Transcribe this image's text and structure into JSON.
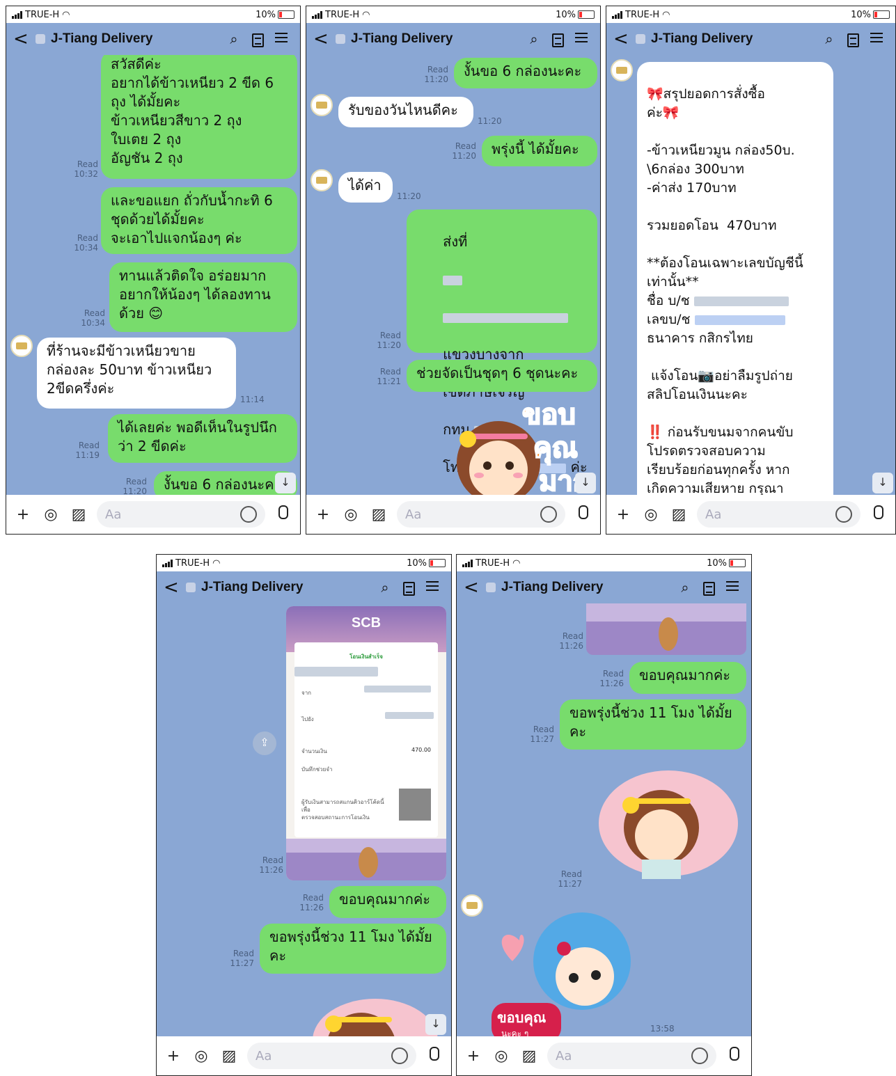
{
  "app": {
    "carrier": "TRUE-H",
    "battery": "10%",
    "chat_title": "J-Tiang Delivery",
    "input_placeholder": "Aa",
    "back_glyph": "<"
  },
  "icons": [
    "back-icon",
    "search-icon",
    "notes-icon",
    "menu-icon",
    "plus-icon",
    "camera-icon",
    "image-icon",
    "emoji-icon",
    "mic-icon"
  ],
  "screen1": {
    "m1": {
      "read": "Read",
      "time": "10:32",
      "text": "สวัสดีค่ะ\nอยากได้ข้าวเหนียว 2 ขีด 6\nถุง ได้มั้ยคะ\nข้าวเหนียวสีขาว 2 ถุง\nใบเตย 2 ถุง\nอัญชัน 2 ถุง"
    },
    "m2": {
      "read": "Read",
      "time": "10:34",
      "text": "และขอแยก ถั่วกับน้ำกะทิ 6\nชุดด้วยได้มั้ยคะ\nจะเอาไปแจกน้องๆ ค่ะ"
    },
    "m3": {
      "read": "Read",
      "time": "10:34",
      "text": "ทานแล้วติดใจ อร่อยมาก\nอยากให้น้องๆ ได้ลองทาน\nด้วย 😊"
    },
    "m4": {
      "time": "11:14",
      "text": "ที่ร้านจะมีข้าวเหนียวขาย\nกล่องละ 50บาท ข้าวเหนียว\n2ขีดครึ่งค่ะ"
    },
    "m5": {
      "read": "Read",
      "time": "11:19",
      "text": "ได้เลยค่ะ พอดีเห็นในรูปนึก\nว่า 2 ขีดค่ะ"
    },
    "m6": {
      "read": "Read",
      "time": "11:20",
      "text": "งั้นขอ 6 กล่องนะค"
    }
  },
  "screen2": {
    "m1": {
      "read": "Read",
      "time": "11:20",
      "text": "งั้นขอ 6 กล่องนะคะ"
    },
    "m2": {
      "time": "11:20",
      "text": "รับของวันไหนดีคะ"
    },
    "m3": {
      "read": "Read",
      "time": "11:20",
      "text": "พรุ่งนี้ ได้มั้ยคะ"
    },
    "m4": {
      "time": "11:20",
      "text": "ได้ค่า"
    },
    "m5": {
      "read": "Read",
      "time": "11:20",
      "line1": "ส่งที่",
      "line2": "แขวงบางจาก",
      "line3": "เขตภาษีเจริญ",
      "line4": "กทม",
      "line5a": "โทร",
      "line5b": "ค่ะ"
    },
    "m6": {
      "read": "Read",
      "time": "11:21",
      "text": "ช่วยจัดเป็นชุดๆ 6 ชุดนะคะ"
    },
    "sticker_text1": "ขอบ",
    "sticker_text2": "คุณ",
    "sticker_text3": "มาก"
  },
  "screen3": {
    "summary_title": "🎀สรุปยอดการสั่งซื้อ\nค่ะ🎀",
    "item_line": "-ข้าวเหนียวมูน กล่อง50บ.\n\\6กล่อง 300บาท\n-ค่าส่ง 170บาท",
    "total": "รวมยอดโอน  470บาท",
    "warn": "**ต้องโอนเฉพาะเลขบัญชีนี้\nเท่านั้น**",
    "acct_name_label": "ชื่อ บ/ช",
    "acct_no_label": "เลขบ/ช",
    "bank": "ธนาคาร กสิกรไทย",
    "notify": " แจ้งโอน📷อย่าลืมรูปถ่าย\nสลิปโอนเงินนะคะ",
    "notice": "‼️ ก่อนรับขนมจากคนขับ\nโปรดตรวจสอบความ\nเรียบร้อยก่อนทุกครั้ง หาก\nเกิดความเสียหาย กรุณา\nอย่าจ่ายค่ารถ และเรียกร้อง"
  },
  "screen4": {
    "slip": {
      "brand": "SCB",
      "status": "โอนเงินสำเร็จ",
      "from_label": "จาก",
      "to_label": "ไปยัง",
      "amount_label": "จำนวนเงิน",
      "amount": "470.00",
      "memo_label": "บันทึกช่วยจำ",
      "qr_note": "ผู้รับเงินสามารถสแกนคิวอาร์โค้ดนี้เพื่อ\nตรวจสอบสถานะการโอนเงิน"
    },
    "img_read": "Read",
    "img_time": "11:26",
    "m1": {
      "read": "Read",
      "time": "11:26",
      "text": "ขอบคุณมากค่ะ"
    },
    "m2": {
      "read": "Read",
      "time": "11:27",
      "text": "ขอพรุ่งนี้ช่วง 11 โมง ได้มั้ย\nคะ"
    }
  },
  "screen5": {
    "img_read": "Read",
    "img_time": "11:26",
    "m1": {
      "read": "Read",
      "time": "11:26",
      "text": "ขอบคุณมากค่ะ"
    },
    "m2": {
      "read": "Read",
      "time": "11:27",
      "text": "ขอพรุ่งนี้ช่วง 11 โมง ได้มั้ย\nคะ"
    },
    "sticker_read": "Read",
    "sticker_time": "11:27",
    "last_time": "13:58",
    "sticker2_text1": "ขอบคุณ",
    "sticker2_text2": "นะคะ ๆ"
  }
}
